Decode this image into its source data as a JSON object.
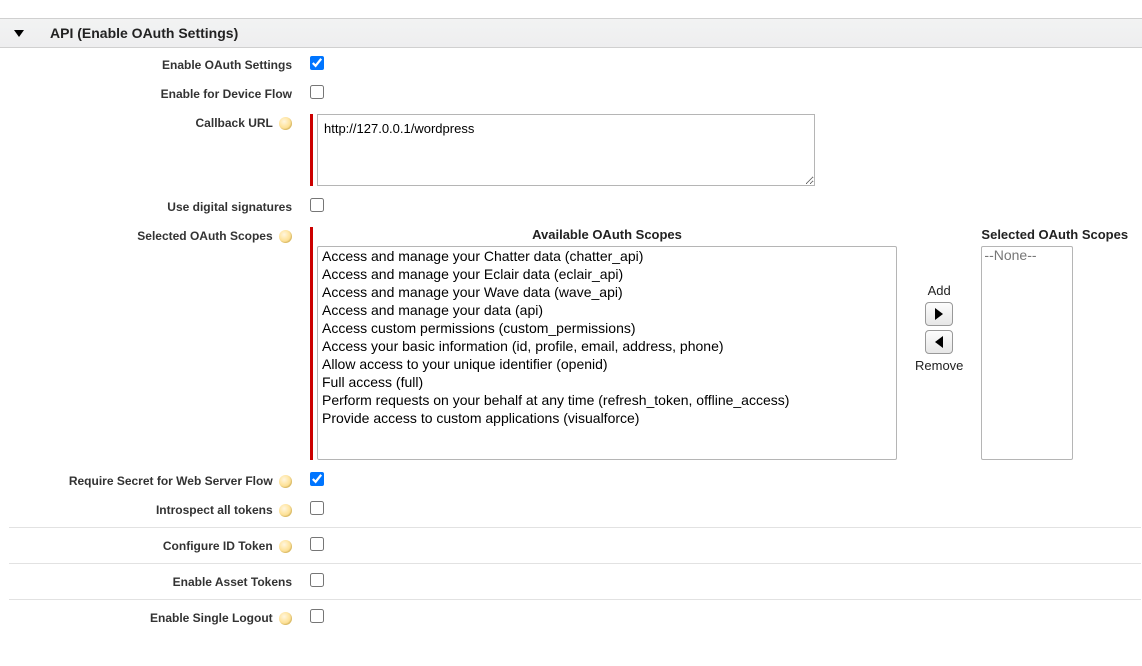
{
  "section": {
    "title": "API (Enable OAuth Settings)"
  },
  "labels": {
    "enable_oauth": "Enable OAuth Settings",
    "enable_device_flow": "Enable for Device Flow",
    "callback_url": "Callback URL",
    "use_digital_signatures": "Use digital signatures",
    "selected_oauth_scopes": "Selected OAuth Scopes",
    "require_secret": "Require Secret for Web Server Flow",
    "introspect_all": "Introspect all tokens",
    "configure_id_token": "Configure ID Token",
    "enable_asset_tokens": "Enable Asset Tokens",
    "enable_single_logout": "Enable Single Logout"
  },
  "values": {
    "callback_url": "http://127.0.0.1/wordpress",
    "enable_oauth_checked": true,
    "enable_device_flow_checked": false,
    "use_digital_signatures_checked": false,
    "require_secret_checked": true,
    "introspect_all_checked": false,
    "configure_id_token_checked": false,
    "enable_asset_tokens_checked": false,
    "enable_single_logout_checked": false
  },
  "scopes": {
    "available_header": "Available OAuth Scopes",
    "selected_header": "Selected OAuth Scopes",
    "add_label": "Add",
    "remove_label": "Remove",
    "none_placeholder": "--None--",
    "available": [
      "Access and manage your Chatter data (chatter_api)",
      "Access and manage your Eclair data (eclair_api)",
      "Access and manage your Wave data (wave_api)",
      "Access and manage your data (api)",
      "Access custom permissions (custom_permissions)",
      "Access your basic information (id, profile, email, address, phone)",
      "Allow access to your unique identifier (openid)",
      "Full access (full)",
      "Perform requests on your behalf at any time (refresh_token, offline_access)",
      "Provide access to custom applications (visualforce)"
    ]
  }
}
